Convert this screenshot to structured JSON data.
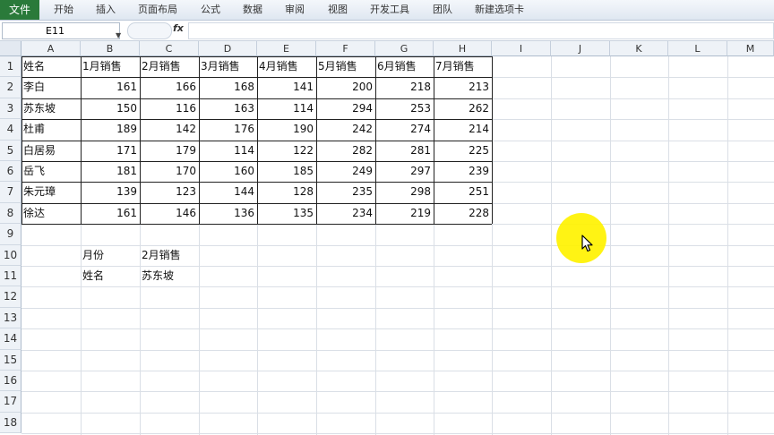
{
  "ribbon": {
    "tabs": [
      "文件",
      "开始",
      "插入",
      "页面布局",
      "公式",
      "数据",
      "审阅",
      "视图",
      "开发工具",
      "团队",
      "新建选项卡"
    ]
  },
  "formula_bar": {
    "name_box": "E11",
    "fx_label": "fx",
    "content": ""
  },
  "columns": [
    "A",
    "B",
    "C",
    "D",
    "E",
    "F",
    "G",
    "H",
    "I",
    "J",
    "K",
    "L",
    "M"
  ],
  "rows": [
    "1",
    "2",
    "3",
    "4",
    "5",
    "6",
    "7",
    "8",
    "9",
    "10",
    "11",
    "12",
    "13",
    "14",
    "15",
    "16",
    "17",
    "18"
  ],
  "table": {
    "headers": [
      "姓名",
      "1月销售",
      "2月销售",
      "3月销售",
      "4月销售",
      "5月销售",
      "6月销售",
      "7月销售"
    ],
    "rows": [
      {
        "name": "李白",
        "values": [
          "161",
          "166",
          "168",
          "141",
          "200",
          "218",
          "213"
        ]
      },
      {
        "name": "苏东坡",
        "values": [
          "150",
          "116",
          "163",
          "114",
          "294",
          "253",
          "262"
        ]
      },
      {
        "name": "杜甫",
        "values": [
          "189",
          "142",
          "176",
          "190",
          "242",
          "274",
          "214"
        ]
      },
      {
        "name": "白居易",
        "values": [
          "171",
          "179",
          "114",
          "122",
          "282",
          "281",
          "225"
        ]
      },
      {
        "name": "岳飞",
        "values": [
          "181",
          "170",
          "160",
          "185",
          "249",
          "297",
          "239"
        ]
      },
      {
        "name": "朱元璋",
        "values": [
          "139",
          "123",
          "144",
          "128",
          "235",
          "298",
          "251"
        ]
      },
      {
        "name": "徐达",
        "values": [
          "161",
          "146",
          "136",
          "135",
          "234",
          "219",
          "228"
        ]
      }
    ]
  },
  "lookup": {
    "month_label": "月份",
    "month_value": "2月销售",
    "name_label": "姓名",
    "name_value": "苏东坡"
  },
  "colors": {
    "file_tab": "#2a7a3a",
    "cursor_highlight": "#fff200"
  }
}
